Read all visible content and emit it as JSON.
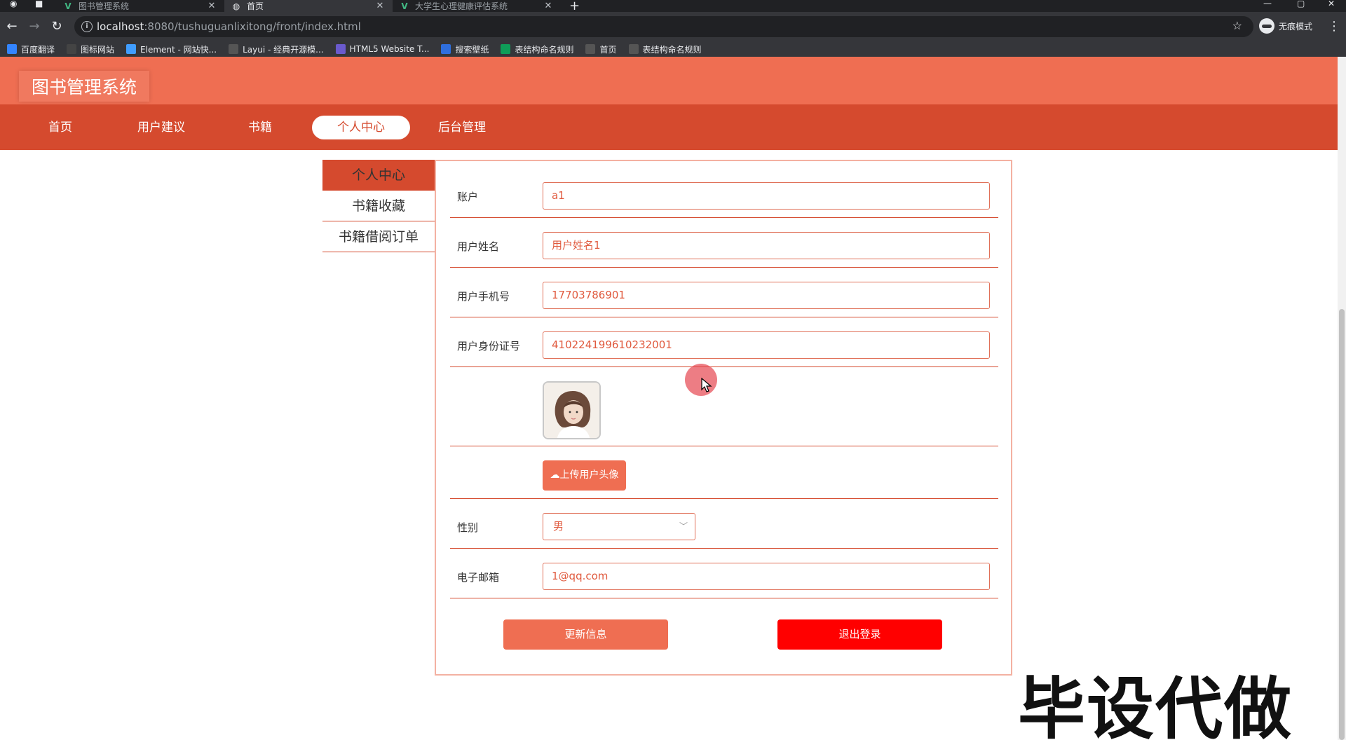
{
  "browser": {
    "tabs": [
      {
        "title": "图书管理系统",
        "icon": "vue-logo-icon",
        "active": false
      },
      {
        "title": "首页",
        "icon": "globe-icon",
        "active": true
      },
      {
        "title": "大学生心理健康评估系统",
        "icon": "vue-logo-icon",
        "active": false
      }
    ],
    "url_host": "localhost",
    "url_rest": ":8080/tushuguanlixitong/front/index.html",
    "incognito_label": "无痕模式",
    "bookmarks": [
      {
        "label": "百度翻译",
        "icon": "translate-icon",
        "color": "#3385ff"
      },
      {
        "label": "图标网站",
        "icon": "flag-icon",
        "color": "#444444"
      },
      {
        "label": "Element - 网站快...",
        "icon": "element-icon",
        "color": "#409eff"
      },
      {
        "label": "Layui - 经典开源模...",
        "icon": "layui-icon",
        "color": "#555555"
      },
      {
        "label": "HTML5 Website T...",
        "icon": "html5-icon",
        "color": "#6a5acd"
      },
      {
        "label": "搜索壁纸",
        "icon": "wallpaper-icon",
        "color": "#2f6fde"
      },
      {
        "label": "表结构命名规则",
        "icon": "sheet-icon",
        "color": "#0f9d58"
      },
      {
        "label": "首页",
        "icon": "globe-icon",
        "color": "#555555"
      },
      {
        "label": "表结构命名规则",
        "icon": "globe-icon",
        "color": "#555555"
      }
    ]
  },
  "site": {
    "title": "图书管理系统",
    "nav": [
      "首页",
      "用户建议",
      "书籍",
      "个人中心",
      "后台管理"
    ],
    "active_nav": "个人中心",
    "colors": {
      "header": "#ef6e52",
      "nav": "#d54a2e",
      "logout": "#ff0000"
    }
  },
  "sidebar": {
    "items": [
      "个人中心",
      "书籍收藏",
      "书籍借阅订单"
    ],
    "active": "个人中心"
  },
  "form": {
    "account": {
      "label": "账户",
      "value": "a1"
    },
    "name": {
      "label": "用户姓名",
      "value": "用户姓名1"
    },
    "phone": {
      "label": "用户手机号",
      "value": "17703786901"
    },
    "idcard": {
      "label": "用户身份证号",
      "value": "410224199610232001"
    },
    "upload_label": "上传用户头像",
    "gender": {
      "label": "性别",
      "value": "男"
    },
    "email": {
      "label": "电子邮箱",
      "value": "1@qq.com"
    },
    "update_label": "更新信息",
    "logout_label": "退出登录"
  },
  "watermark": "毕设代做"
}
